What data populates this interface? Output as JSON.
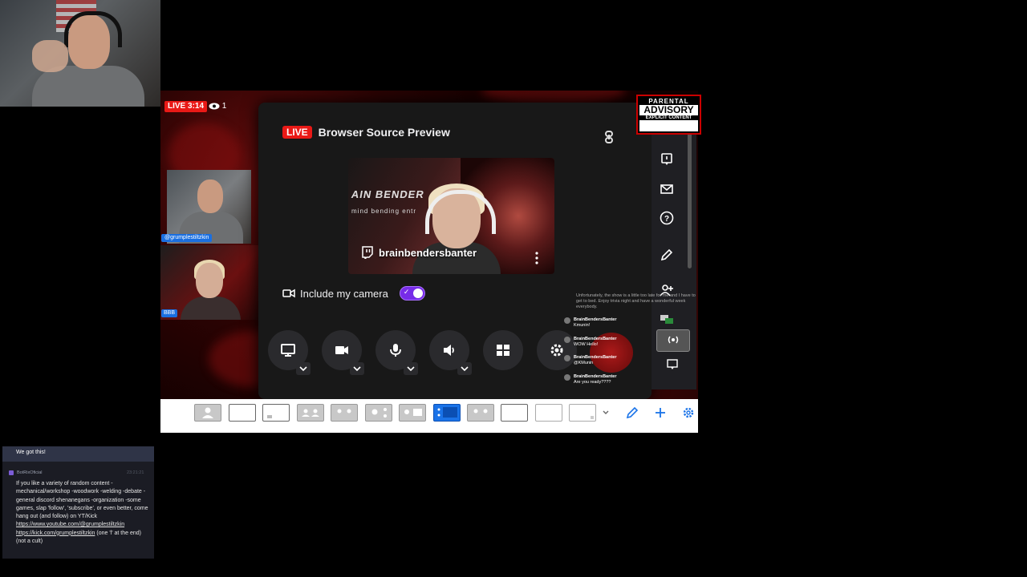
{
  "stream": {
    "live_label": "LIVE 3:14",
    "viewer_count": "1",
    "guest1_tag": "@grumplestiltzkin",
    "guest2_tag": "BBB"
  },
  "modal": {
    "live_tag": "LIVE",
    "title": "Browser Source Preview",
    "preview_brand": "AIN BENDER",
    "preview_sub": "mind bending entr",
    "preview_channel": "brainbendersbanter",
    "include_camera_label": "Include my camera",
    "include_camera_on": true
  },
  "parental_advisory": {
    "line1": "PARENTAL",
    "line2": "ADVISORY",
    "line3": "EXPLICIT CONTENT"
  },
  "overlay_chat": {
    "faded_text": "Unfortunately, the show is a little too late for me and I have to get to bed. Enjoy trivia night and have a wonderful week everybody.",
    "messages": [
      {
        "user": "BrainBendersBanter",
        "text": "Kmunin!"
      },
      {
        "user": "BrainBendersBanter",
        "text": "WOW Hello!"
      },
      {
        "user": "BrainBendersBanter",
        "text": "@KMunin"
      },
      {
        "user": "BrainBendersBanter",
        "text": "Are you ready????"
      }
    ]
  },
  "chat_panel": {
    "message1": "We got this!",
    "bot_name": "BotRixOficial",
    "bot_time": "23:21:21",
    "bot_text": "If you like a variety of random content -mechanical/workshop -woodwork -welding -debate -general discord shenanegans -organization -some games, slap 'follow', 'subscribe', or even better, come hang out (and follow) on YT/Kick",
    "link1": "https://www.youtube.com/@grumplestiltzkin",
    "link2": "https://kick.com/grumplestiltzkin",
    "bot_tail": " (one 'l' at the end) (not a cult)"
  },
  "colors": {
    "accent_purple": "#772ce8",
    "live_red": "#e91916",
    "layout_selected": "#1a73e8"
  }
}
